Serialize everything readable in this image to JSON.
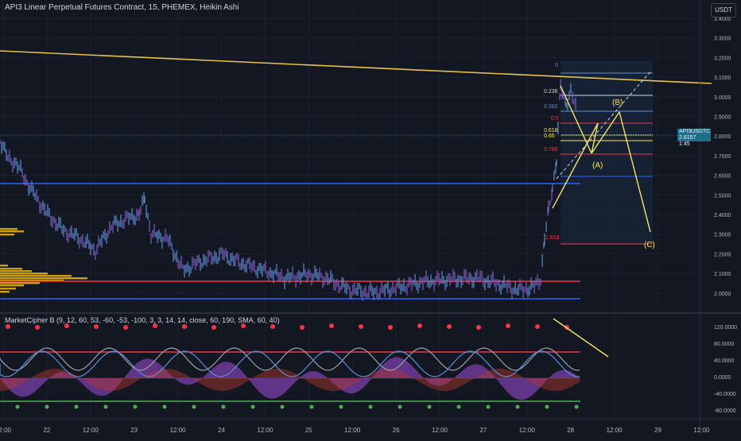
{
  "header": {
    "title": "API3 Linear Perpetual Futures Contract, 15, PHEMEX, Heikin Ashi",
    "currency": "USDT"
  },
  "price_axis": {
    "labels": [
      "3.4000",
      "3.3000",
      "3.2000",
      "3.1000",
      "3.0000",
      "2.9000",
      "2.8000",
      "2.7000",
      "2.6000",
      "2.5000",
      "2.4000",
      "2.3000",
      "2.2000",
      "2.1000",
      "2.0000"
    ],
    "current_price_tag": "API3USDTC 2.8157",
    "current_price_sub": "1:45"
  },
  "indicator": {
    "title": "MarketCipher B (9, 12, 60, 53, -60, -53, -100, 3, 3, 14, 14, close, 60, 190, SMA, 60, 40)",
    "axis_labels": [
      "120.0000",
      "80.0000",
      "40.0000",
      "0.0000",
      "-40.0000",
      "-80.0000"
    ]
  },
  "time_axis": {
    "labels": [
      "12:00",
      "22",
      "12:00",
      "23",
      "12:00",
      "24",
      "12:00",
      "25",
      "12:00",
      "26",
      "12:00",
      "27",
      "12:00",
      "28",
      "12:00",
      "29",
      "12:00"
    ]
  },
  "fib_levels": [
    "0",
    "0.236",
    "0.382",
    "0.5",
    "0.618",
    "0.65",
    "0.786",
    "1.618"
  ],
  "wave_labels": [
    "(A)",
    "(B)",
    "(C)"
  ],
  "colors": {
    "background": "#131722",
    "trendline": "#e8c34a",
    "support_blue": "#2962ff",
    "resistance_red": "#f23645",
    "candles": "#5b8fd6",
    "volume_profile": "#f0b90b",
    "wave": "#f5e663"
  }
}
